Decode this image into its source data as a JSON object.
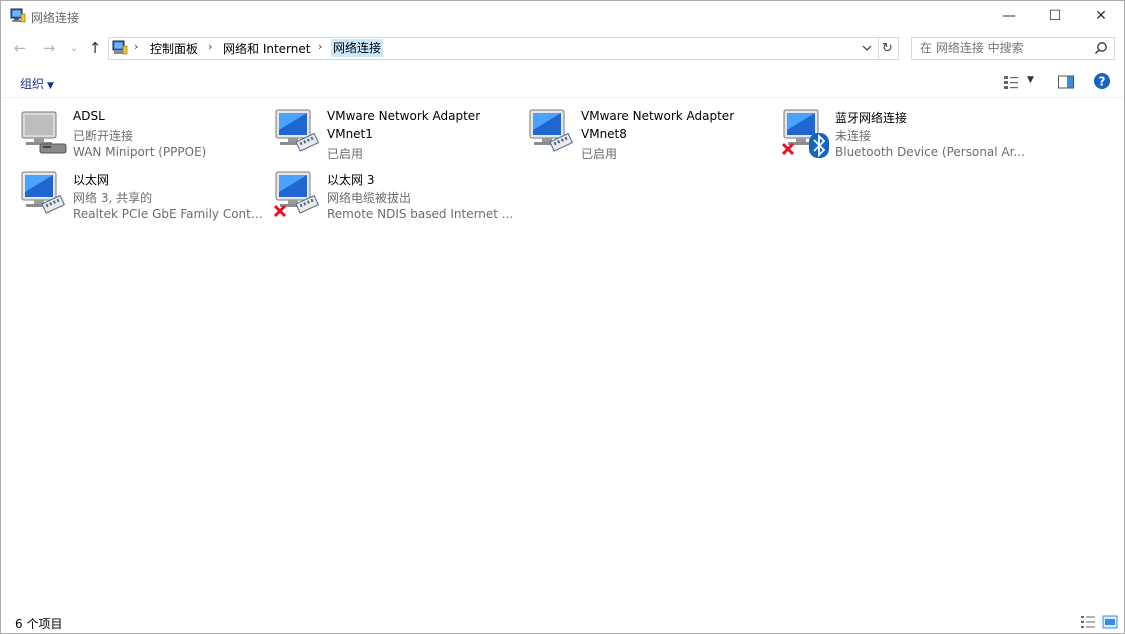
{
  "window": {
    "title": "网络连接"
  },
  "caption": {
    "minimize": "—",
    "maximize": "☐",
    "close": "✕"
  },
  "nav": {
    "back": "←",
    "forward": "→",
    "recent": "⌄",
    "up": "↑",
    "sep": "›"
  },
  "breadcrumb": [
    "控制面板",
    "网络和 Internet",
    "网络连接"
  ],
  "refresh_glyph": "↻",
  "search": {
    "placeholder": "在 网络连接 中搜索"
  },
  "toolbar": {
    "organize": "组织",
    "caret": "▼",
    "view_caret": "▼"
  },
  "items": [
    {
      "name": "ADSL",
      "status": "已断开连接",
      "device": "WAN Miniport (PPPOE)",
      "icon": "dialup-connection-icon",
      "disabled": false
    },
    {
      "name": "VMware Network Adapter VMnet1",
      "line1": "VMware Network Adapter",
      "line2": "VMnet1",
      "status": "已启用",
      "icon": "network-adapter-icon",
      "disabled": false
    },
    {
      "name": "VMware Network Adapter VMnet8",
      "line1": "VMware Network Adapter",
      "line2": "VMnet8",
      "status": "已启用",
      "icon": "network-adapter-icon",
      "disabled": false
    },
    {
      "name": "蓝牙网络连接",
      "status": "未连接",
      "device": "Bluetooth Device (Personal Ar...",
      "icon": "bluetooth-adapter-icon",
      "disabled": true
    },
    {
      "name": "以太网",
      "status": "网络 3, 共享的",
      "device": "Realtek PCIe GbE Family Contr...",
      "icon": "network-adapter-icon",
      "disabled": false
    },
    {
      "name": "以太网 3",
      "status": "网络电缆被拔出",
      "device": "Remote NDIS based Internet ...",
      "icon": "network-adapter-icon",
      "disabled": true
    }
  ],
  "status": {
    "count": "6 个项目"
  },
  "colors": {
    "accent": "#0078d7",
    "selection": "#cce8ff",
    "organize": "#1e3287",
    "error": "#e81123",
    "help": "#1565c0"
  }
}
